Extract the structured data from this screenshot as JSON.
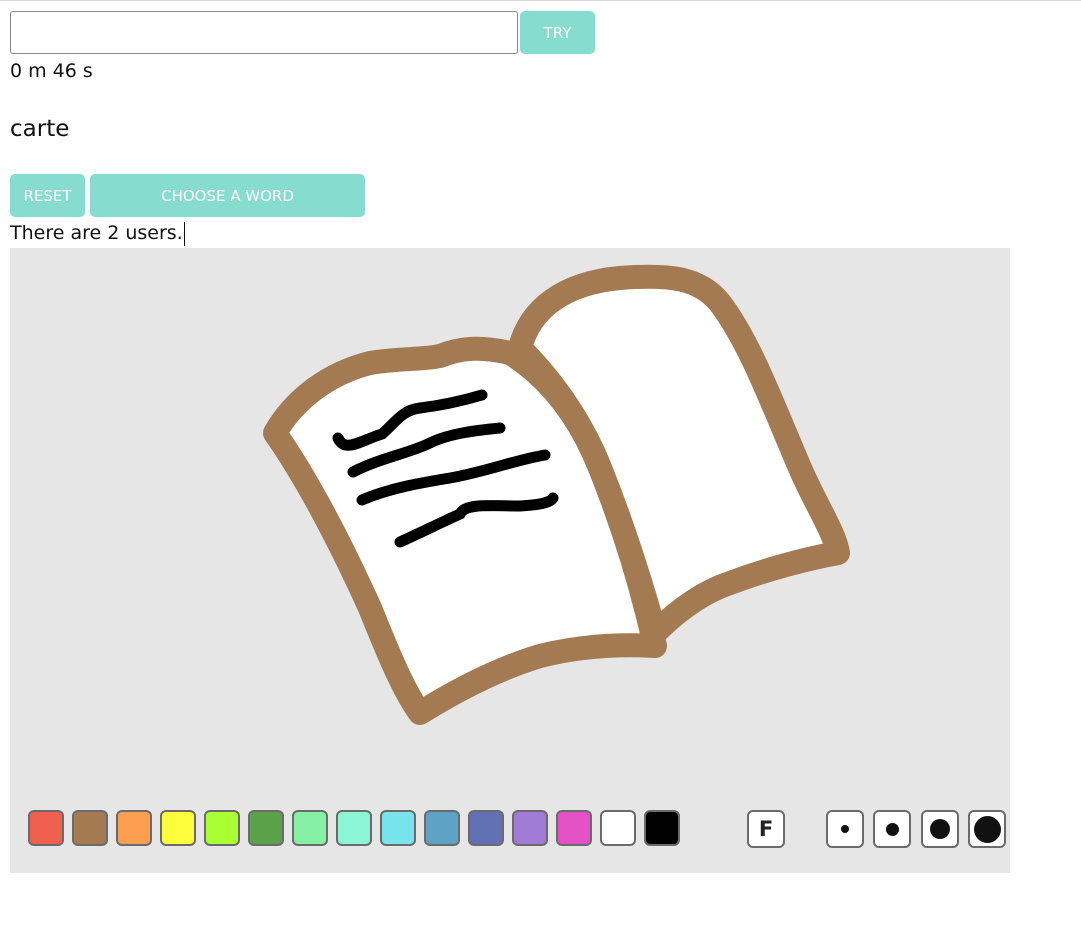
{
  "guess": {
    "value": "",
    "placeholder": "",
    "button_label": "TRY"
  },
  "timer": "0 m 46 s",
  "word": "carte",
  "controls": {
    "reset_label": "RESET",
    "choose_label": "CHOOSE A WORD"
  },
  "users_text": "There are 2 users.",
  "accent_color": "#86dccf",
  "canvas": {
    "background": "#e6e6e6"
  },
  "palette": [
    {
      "name": "red",
      "color": "#f0604e"
    },
    {
      "name": "brown",
      "color": "#a37a51"
    },
    {
      "name": "orange",
      "color": "#fc9e4f"
    },
    {
      "name": "yellow",
      "color": "#fffc3b"
    },
    {
      "name": "lime",
      "color": "#aaff33"
    },
    {
      "name": "green",
      "color": "#5aa14a"
    },
    {
      "name": "light-green",
      "color": "#86f0a4"
    },
    {
      "name": "mint",
      "color": "#8cf5d5"
    },
    {
      "name": "cyan",
      "color": "#77e3ec"
    },
    {
      "name": "steel-blue",
      "color": "#5ea3c6"
    },
    {
      "name": "indigo",
      "color": "#6171b3"
    },
    {
      "name": "purple",
      "color": "#a17bd6"
    },
    {
      "name": "magenta",
      "color": "#e351c4"
    },
    {
      "name": "white",
      "color": "#ffffff"
    },
    {
      "name": "black",
      "color": "#000000"
    }
  ],
  "fill_tool": {
    "label": "F",
    "icon": "fill-icon"
  },
  "brush_sizes": [
    "small",
    "medium",
    "large",
    "x-large"
  ]
}
